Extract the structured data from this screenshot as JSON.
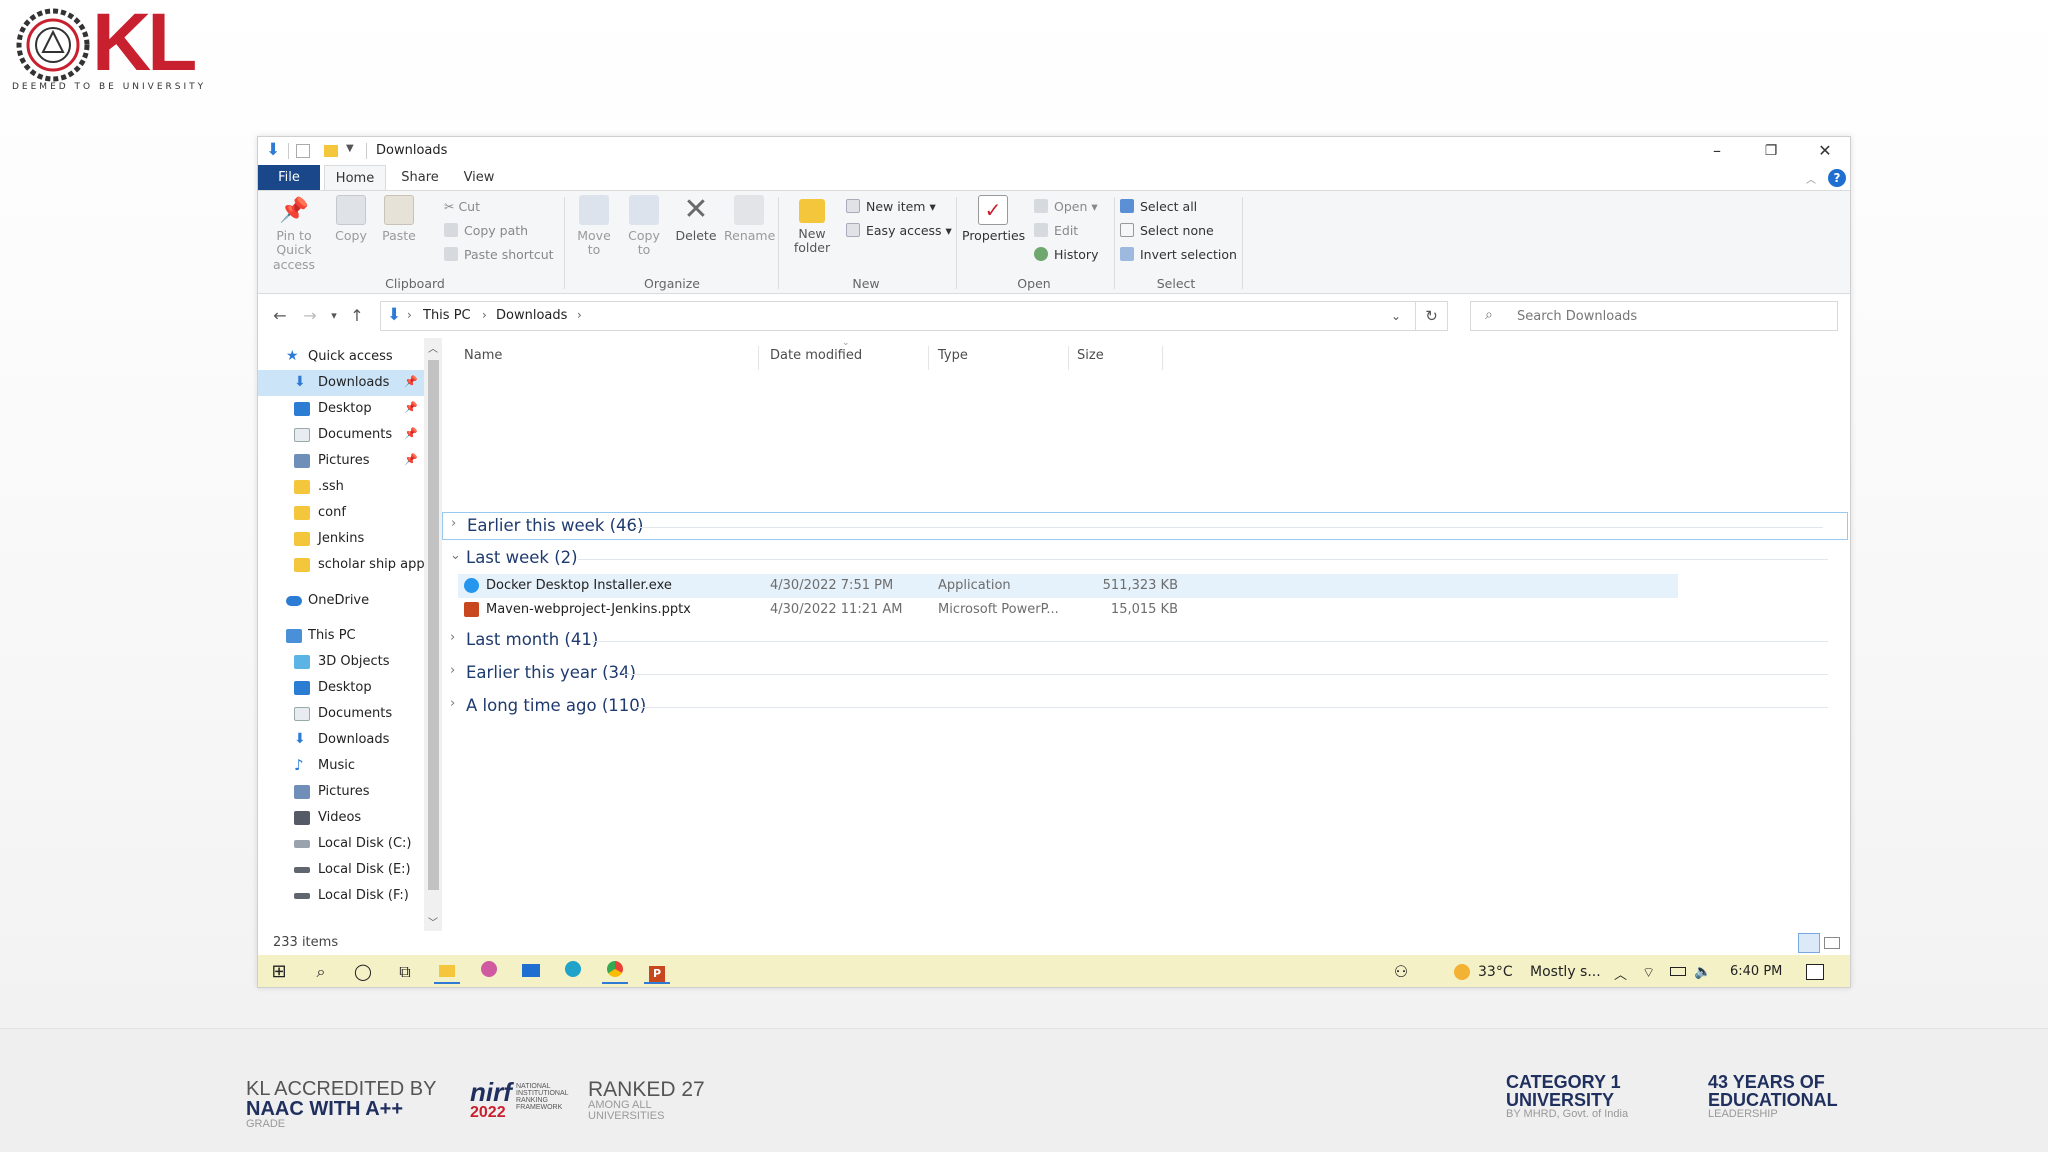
{
  "branding": {
    "logo_letters": "KL",
    "logo_subtitle": "DEEMED TO BE UNIVERSITY",
    "badges": {
      "naac_line1": "KL ACCREDITED BY",
      "naac_line2": "NAAC WITH A++",
      "naac_line3": "GRADE",
      "nirf_mark": "nirf",
      "nirf_year": "2022",
      "nirf_small": "NATIONAL INSTITUTIONAL RANKING FRAMEWORK",
      "ranked_line1": "RANKED 27",
      "ranked_line2": "AMONG ALL UNIVERSITIES",
      "category_line1": "CATEGORY 1",
      "category_line2": "UNIVERSITY",
      "category_line3": "BY MHRD, Govt. of India",
      "years_line1": "43 YEARS OF",
      "years_line2": "EDUCATIONAL",
      "years_line3": "LEADERSHIP"
    }
  },
  "window": {
    "title": "Downloads",
    "controls": {
      "minimize": "–",
      "restore": "❐",
      "close": "✕"
    }
  },
  "ribbon_tabs": [
    "File",
    "Home",
    "Share",
    "View"
  ],
  "ribbon": {
    "clipboard": {
      "pin": "Pin to Quick access",
      "copy": "Copy",
      "paste": "Paste",
      "cut": "Cut",
      "copy_path": "Copy path",
      "paste_shortcut": "Paste shortcut",
      "label": "Clipboard"
    },
    "organize": {
      "move_to": "Move to",
      "copy_to": "Copy to",
      "delete": "Delete",
      "rename": "Rename",
      "label": "Organize"
    },
    "new": {
      "new_folder": "New folder",
      "new_item": "New item",
      "easy_access": "Easy access",
      "label": "New"
    },
    "open": {
      "properties": "Properties",
      "open": "Open",
      "edit": "Edit",
      "history": "History",
      "label": "Open"
    },
    "select": {
      "select_all": "Select all",
      "select_none": "Select none",
      "invert": "Invert selection",
      "label": "Select"
    }
  },
  "address": {
    "crumbs": [
      "This PC",
      "Downloads"
    ],
    "search_placeholder": "Search Downloads"
  },
  "nav": {
    "quick_access": "Quick access",
    "quick_items": [
      "Downloads",
      "Desktop",
      "Documents",
      "Pictures",
      ".ssh",
      "conf",
      "Jenkins",
      "scholar ship app"
    ],
    "onedrive": "OneDrive",
    "this_pc": "This PC",
    "pc_items": [
      "3D Objects",
      "Desktop",
      "Documents",
      "Downloads",
      "Music",
      "Pictures",
      "Videos",
      "Local Disk (C:)",
      "Local Disk (E:)",
      "Local Disk (F:)"
    ]
  },
  "columns": [
    "Name",
    "Date modified",
    "Type",
    "Size"
  ],
  "groups": {
    "g1": "Earlier this week (46)",
    "g2": "Last week (2)",
    "g3": "Last month (41)",
    "g4": "Earlier this year (34)",
    "g5": "A long time ago (110)"
  },
  "files": [
    {
      "name": "Docker Desktop Installer.exe",
      "date": "4/30/2022 7:51 PM",
      "type": "Application",
      "size": "511,323 KB"
    },
    {
      "name": "Maven-webproject-Jenkins.pptx",
      "date": "4/30/2022 11:21 AM",
      "type": "Microsoft PowerP...",
      "size": "15,015 KB"
    }
  ],
  "status": {
    "items": "233 items"
  },
  "taskbar": {
    "temperature": "33°C",
    "weather": "Mostly s...",
    "time": "6:40 PM"
  }
}
